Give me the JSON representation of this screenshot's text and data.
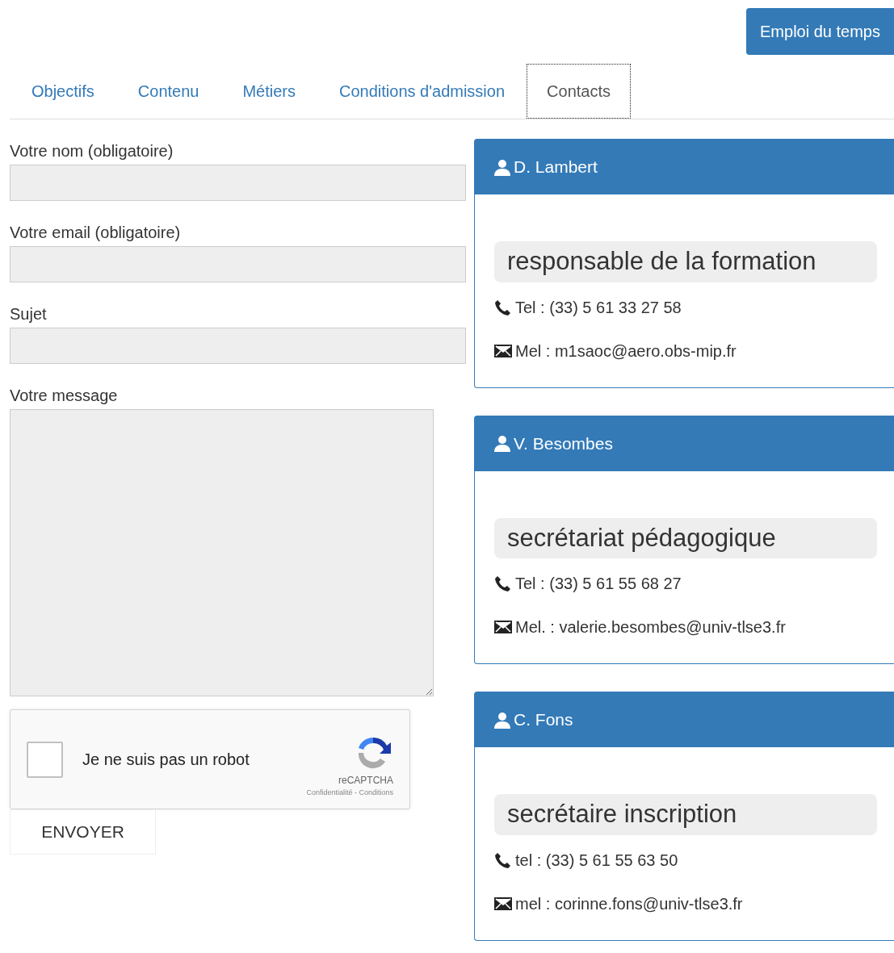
{
  "header_button": "Emploi du temps",
  "tabs": [
    {
      "label": "Objectifs",
      "selected": false
    },
    {
      "label": "Contenu",
      "selected": false
    },
    {
      "label": "Métiers",
      "selected": false
    },
    {
      "label": "Conditions d'admission",
      "selected": false
    },
    {
      "label": "Contacts",
      "selected": true
    }
  ],
  "form": {
    "fields": [
      {
        "label": "Votre nom (obligatoire)",
        "kind": "input"
      },
      {
        "label": "Votre email (obligatoire)",
        "kind": "input"
      },
      {
        "label": "Sujet",
        "kind": "input"
      },
      {
        "label": "Votre message",
        "kind": "textarea"
      }
    ],
    "captcha": {
      "label": "Je ne suis pas un robot",
      "checked": false,
      "brand": "reCAPTCHA",
      "links": "Confidentialité - Conditions"
    },
    "submit": "ENVOYER"
  },
  "contacts": [
    {
      "name": "D. Lambert",
      "role": "responsable de la formation",
      "lines": [
        {
          "kind": "phone",
          "text": "Tel : (33) 5 61 33 27 58"
        },
        {
          "kind": "email",
          "text": "Mel : m1saoc@aero.obs-mip.fr"
        }
      ]
    },
    {
      "name": "V. Besombes",
      "role": "secrétariat pédagogique",
      "lines": [
        {
          "kind": "phone",
          "text": "Tel : (33) 5 61 55 68 27"
        },
        {
          "kind": "email",
          "text": "Mel. : valerie.besombes@univ-tlse3.fr"
        }
      ]
    },
    {
      "name": "C. Fons",
      "role": "secrétaire inscription",
      "lines": [
        {
          "kind": "phone",
          "text": "tel : (33) 5 61 55 63 50"
        },
        {
          "kind": "email",
          "text": "mel : corinne.fons@univ-tlse3.fr"
        }
      ]
    }
  ]
}
